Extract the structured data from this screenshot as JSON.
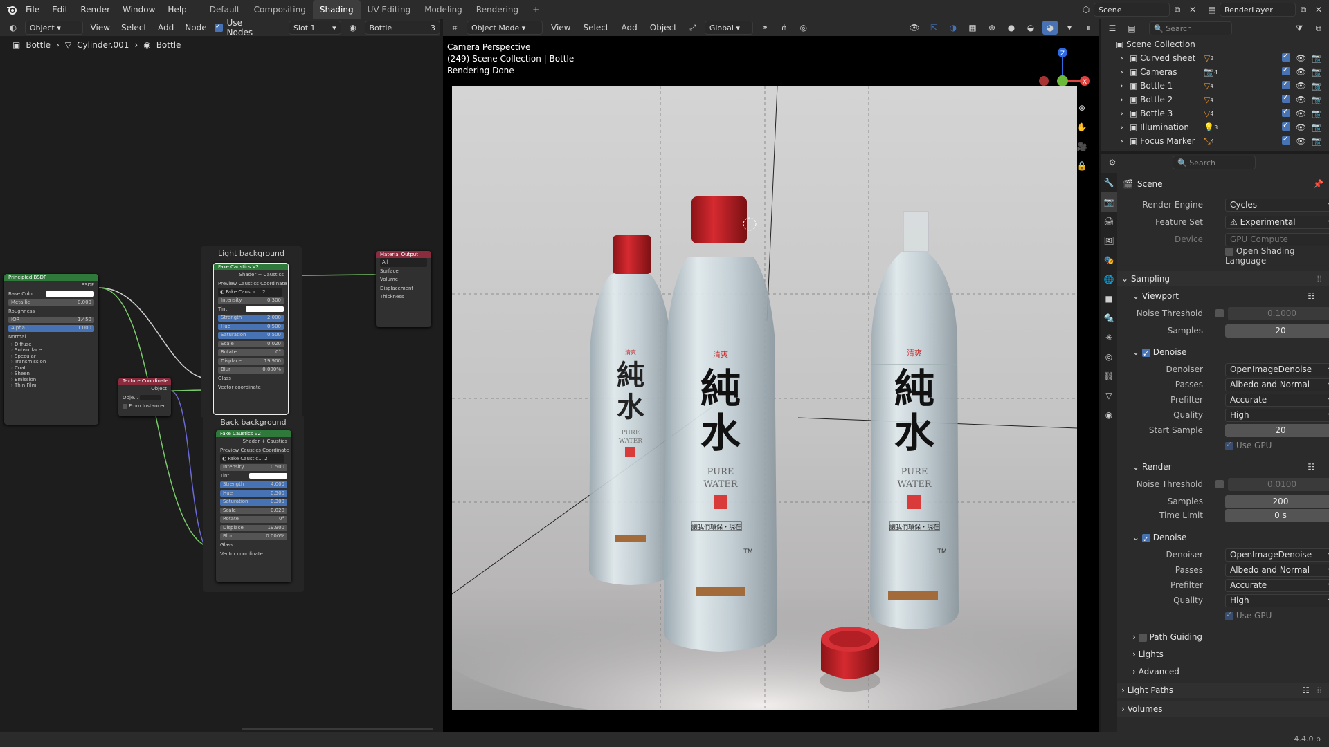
{
  "topbar": {
    "menus": [
      "File",
      "Edit",
      "Render",
      "Window",
      "Help"
    ],
    "workspaces": [
      "Default",
      "Compositing",
      "Shading",
      "UV Editing",
      "Modeling",
      "Rendering"
    ],
    "active_workspace": "Shading",
    "add_tab": "+",
    "scene": "Scene",
    "view_layer": "RenderLayer"
  },
  "node_editor": {
    "header": {
      "editor_type": "Object",
      "menus": [
        "View",
        "Select",
        "Add",
        "Node"
      ],
      "use_nodes_label": "Use Nodes",
      "slot": "Slot 1",
      "material": "Bottle",
      "users": "3"
    },
    "breadcrumb": [
      "Bottle",
      "Cylinder.001",
      "Bottle"
    ],
    "frames": [
      {
        "title": "Light background"
      },
      {
        "title": "Back background"
      }
    ],
    "principled": {
      "title": "Principled BSDF",
      "output": "BSDF",
      "rows": [
        {
          "label": "Base Color",
          "value": ""
        },
        {
          "label": "Metallic",
          "value": "0.000"
        },
        {
          "label": "Roughness",
          "value": ""
        },
        {
          "label": "IOR",
          "value": "1.450"
        },
        {
          "label": "Alpha",
          "value": "1.000"
        },
        {
          "label": "Normal",
          "value": ""
        }
      ],
      "panels": [
        "Diffuse",
        "Subsurface",
        "Specular",
        "Transmission",
        "Coat",
        "Sheen",
        "Emission",
        "Thin Film"
      ]
    },
    "texcoord": {
      "title": "Texture Coordinate",
      "output": "Object",
      "obj_label": "Obje...",
      "from_instancer": "From Instancer"
    },
    "material_output": {
      "title": "Material Output",
      "target": "All",
      "inputs": [
        "Surface",
        "Volume",
        "Displacement",
        "Thickness"
      ]
    },
    "fake1": {
      "title": "Fake Caustics V2",
      "out1": "Shader + Caustics",
      "out2": "Preview Caustics Coordinate",
      "group": "Fake Caustic...",
      "group_users": "2",
      "rows": [
        {
          "label": "Intensity",
          "value": "0.300"
        },
        {
          "label": "Tint",
          "value": ""
        },
        {
          "label": "Strength",
          "value": "2.000"
        },
        {
          "label": "Hue",
          "value": "0.500"
        },
        {
          "label": "Saturation",
          "value": "0.500"
        },
        {
          "label": "Scale",
          "value": "0.020"
        },
        {
          "label": "Rotate",
          "value": "0°"
        },
        {
          "label": "Displace",
          "value": "19.900"
        },
        {
          "label": "Blur",
          "value": "0.000%"
        }
      ],
      "in1": "Glass",
      "in2": "Vector coordinate"
    },
    "fake2": {
      "title": "Fake Caustics V2",
      "out1": "Shader + Caustics",
      "out2": "Preview Caustics Coordinate",
      "group": "Fake Caustic...",
      "group_users": "2",
      "rows": [
        {
          "label": "Intensity",
          "value": "0.500"
        },
        {
          "label": "Tint",
          "value": ""
        },
        {
          "label": "Strength",
          "value": "4.000"
        },
        {
          "label": "Hue",
          "value": "0.500"
        },
        {
          "label": "Saturation",
          "value": "0.300"
        },
        {
          "label": "Scale",
          "value": "0.020"
        },
        {
          "label": "Rotate",
          "value": "0°"
        },
        {
          "label": "Displace",
          "value": "19.900"
        },
        {
          "label": "Blur",
          "value": "0.000%"
        }
      ],
      "in1": "Glass",
      "in2": "Vector coordinate"
    }
  },
  "viewport": {
    "header": {
      "mode": "Object Mode",
      "menus": [
        "View",
        "Select",
        "Add",
        "Object"
      ],
      "orientation": "Global"
    },
    "overlay": {
      "line1": "Camera Perspective",
      "line2": "(249) Scene Collection | Bottle",
      "line3": "Rendering Done"
    },
    "gizmo": {
      "z": "Z",
      "x": "X"
    },
    "bottle_text": {
      "brand": "清爽",
      "big1": "純",
      "big2": "水",
      "pure": "PURE",
      "water": "WATER",
      "tagline": "讓我們環保・現在",
      "tm": "TM"
    }
  },
  "outliner": {
    "root": "Scene Collection",
    "search_placeholder": "Search",
    "items": [
      {
        "name": "Curved sheet",
        "count": "2"
      },
      {
        "name": "Cameras",
        "count": "4"
      },
      {
        "name": "Bottle 1",
        "count": "4"
      },
      {
        "name": "Bottle 2",
        "count": "4"
      },
      {
        "name": "Bottle 3",
        "count": "4"
      },
      {
        "name": "Illumination",
        "count": "3"
      },
      {
        "name": "Focus Marker",
        "count": "4"
      }
    ]
  },
  "properties": {
    "search_placeholder": "Search",
    "context": "Scene",
    "render_engine_label": "Render Engine",
    "render_engine": "Cycles",
    "feature_set_label": "Feature Set",
    "feature_set": "Experimental",
    "device_label": "Device",
    "device": "GPU Compute",
    "osl_label": "Open Shading Language",
    "sampling": "Sampling",
    "viewport": {
      "title": "Viewport",
      "noise_label": "Noise Threshold",
      "noise": "0.1000",
      "samples_label": "Samples",
      "samples": "20",
      "denoise": "Denoise",
      "denoiser_label": "Denoiser",
      "denoiser": "OpenImageDenoise",
      "passes_label": "Passes",
      "passes": "Albedo and Normal",
      "prefilter_label": "Prefilter",
      "prefilter": "Accurate",
      "quality_label": "Quality",
      "quality": "High",
      "start_sample_label": "Start Sample",
      "start_sample": "20",
      "use_gpu": "Use GPU"
    },
    "render": {
      "title": "Render",
      "noise_label": "Noise Threshold",
      "noise": "0.0100",
      "samples_label": "Samples",
      "samples": "200",
      "time_limit_label": "Time Limit",
      "time_limit": "0 s",
      "denoise": "Denoise",
      "denoiser_label": "Denoiser",
      "denoiser": "OpenImageDenoise",
      "passes_label": "Passes",
      "passes": "Albedo and Normal",
      "prefilter_label": "Prefilter",
      "prefilter": "Accurate",
      "quality_label": "Quality",
      "quality": "High",
      "use_gpu": "Use GPU"
    },
    "path_guiding": "Path Guiding",
    "lights": "Lights",
    "advanced": "Advanced",
    "light_paths": "Light Paths",
    "volumes": "Volumes"
  },
  "statusbar": {
    "version": "4.4.0 b"
  },
  "colors": {
    "accent": "#4772b3",
    "bg": "#1d1d1d",
    "panel": "#2b2b2b",
    "shader_header": "#2f7a3a",
    "input_header": "#8a2b3e",
    "output_header": "#8a2b3e",
    "cap": "#c9252b"
  }
}
